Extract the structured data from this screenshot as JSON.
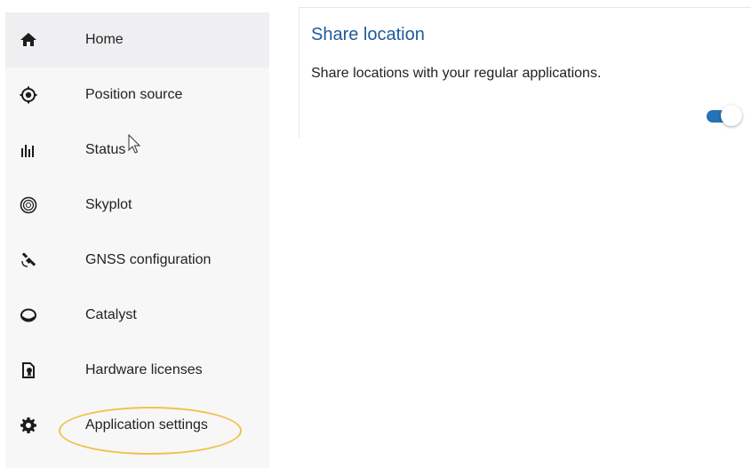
{
  "sidebar": {
    "items": [
      {
        "label": "Home",
        "icon": "home-icon"
      },
      {
        "label": "Position source",
        "icon": "target-icon"
      },
      {
        "label": "Status",
        "icon": "bar-chart-icon"
      },
      {
        "label": "Skyplot",
        "icon": "skyplot-icon"
      },
      {
        "label": "GNSS configuration",
        "icon": "satellite-icon"
      },
      {
        "label": "Catalyst",
        "icon": "catalyst-icon"
      },
      {
        "label": "Hardware licenses",
        "icon": "license-icon"
      },
      {
        "label": "Application settings",
        "icon": "gear-icon"
      }
    ]
  },
  "main": {
    "section": {
      "title": "Share location",
      "description": "Share locations with your regular applications.",
      "toggle_on": true
    }
  },
  "colors": {
    "accent": "#2472b8",
    "title": "#1f5a99",
    "highlight": "#f2c14e"
  }
}
